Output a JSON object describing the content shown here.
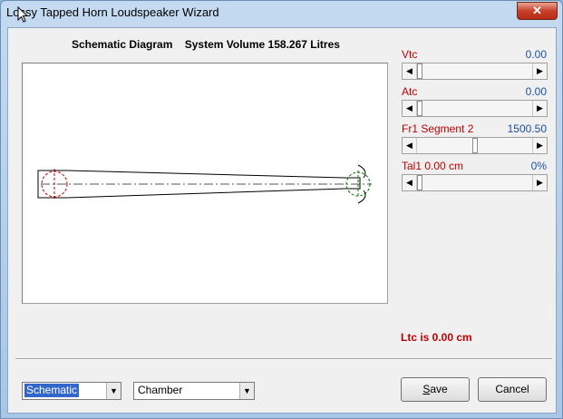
{
  "window": {
    "title": "Lossy Tapped Horn Loudspeaker Wizard",
    "close_label": "✕"
  },
  "heading": {
    "diagram_label": "Schematic Diagram",
    "volume_label": "System Volume 158.267 Litres"
  },
  "params": [
    {
      "label": "Vtc",
      "value": "0.00",
      "slider_fraction": 0.0
    },
    {
      "label": "Atc",
      "value": "0.00",
      "slider_fraction": 0.0
    },
    {
      "label": "Fr1  Segment 2",
      "value": "1500.50",
      "slider_fraction": 0.5
    },
    {
      "label": "Tal1  0.00 cm",
      "value": "0%",
      "slider_fraction": 0.0
    }
  ],
  "ltc_text": "Ltc is 0.00 cm",
  "view_select": {
    "value": "Schematic"
  },
  "mode_select": {
    "value": "Chamber"
  },
  "buttons": {
    "save_prefix": "S",
    "save_rest": "ave",
    "cancel": "Cancel"
  },
  "colors": {
    "param_label": "#c00000",
    "param_value": "#1f4fa0",
    "ltc": "#c00000",
    "driver_circle": "#cc0000",
    "port_circle": "#007700"
  },
  "icons": {
    "cursor": "mouse-pointer-icon",
    "dropdown": "chevron-down-icon",
    "scroll_left": "arrow-left-icon",
    "scroll_right": "arrow-right-icon"
  }
}
